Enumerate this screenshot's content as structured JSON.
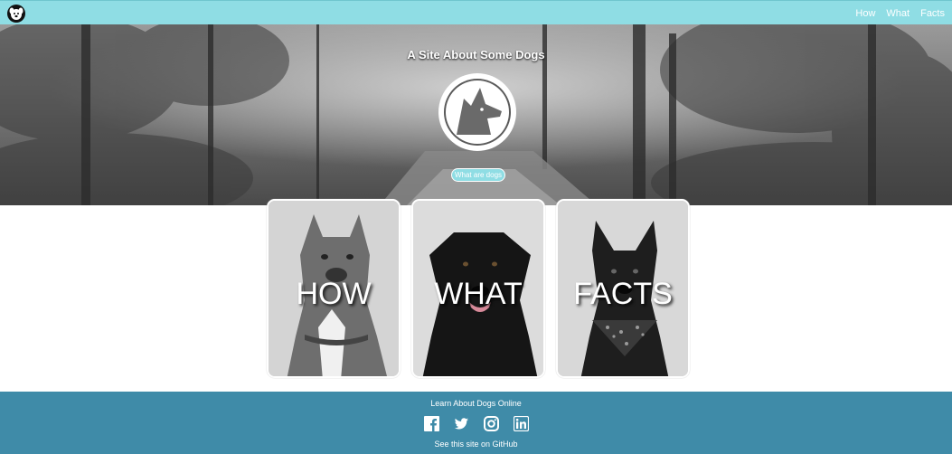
{
  "nav": {
    "logo_icon": "dog-face-icon",
    "links": [
      {
        "label": "How"
      },
      {
        "label": "What"
      },
      {
        "label": "Facts"
      }
    ]
  },
  "hero": {
    "title": "A Site About Some Dogs",
    "emblem_icon": "dog-head-emblem-icon",
    "button_label": "What are dogs"
  },
  "cards": [
    {
      "label": "HOW",
      "image": "pit-bull-photo"
    },
    {
      "label": "WHAT",
      "image": "black-labrador-photo"
    },
    {
      "label": "FACTS",
      "image": "black-dog-bandana-photo"
    }
  ],
  "footer": {
    "title": "Learn About Dogs Online",
    "social_icons": [
      "facebook-icon",
      "twitter-icon",
      "instagram-icon",
      "linkedin-icon"
    ],
    "link_label": "See this site on GitHub"
  },
  "colors": {
    "nav_bg": "#8fdde4",
    "footer_bg": "#3f8ba8",
    "button_bg": "#8fdde4"
  }
}
